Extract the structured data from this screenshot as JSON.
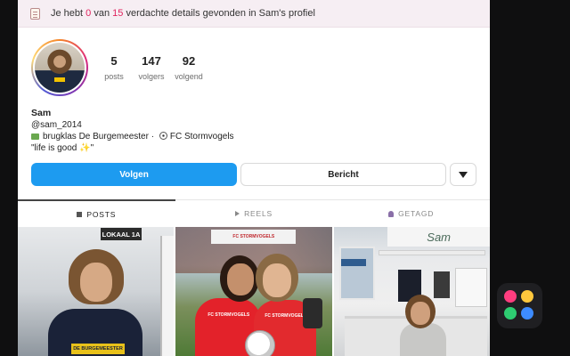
{
  "banner": {
    "prefix": "Je hebt",
    "found": "0",
    "middle": "van",
    "total": "15",
    "suffix": "verdachte details gevonden in Sam's profiel"
  },
  "profile": {
    "stats": [
      {
        "value": "5",
        "label": "posts"
      },
      {
        "value": "147",
        "label": "volgers"
      },
      {
        "value": "92",
        "label": "volgend"
      }
    ],
    "name": "Sam",
    "handle": "@sam_2014",
    "bio_school": "brugklas De Burgemeester",
    "bio_separator": "·",
    "bio_club": "FC Stormvogels",
    "bio_quote": "\"life is good ✨\""
  },
  "actions": {
    "follow_label": "Volgen",
    "message_label": "Bericht"
  },
  "tabs": [
    {
      "label": "POSTS",
      "icon": "grid-icon",
      "active": true
    },
    {
      "label": "REELS",
      "icon": "play-icon",
      "active": false
    },
    {
      "label": "GETAGD",
      "icon": "tagged-person-icon",
      "active": false
    }
  ],
  "posts": [
    {
      "sign": "LOKAAL 1A",
      "hoodie_text": "DE BURGEMEESTER"
    },
    {
      "banner_text": "FC STORMVOGELS",
      "shirt_text_1": "FC STORMVOGELS",
      "shirt_text_2": "FC STORMVOGELS"
    },
    {
      "board_text": "Sam"
    }
  ],
  "colors": {
    "accent": "#1d9bf0",
    "highlight_number": "#e0245e",
    "app_dots": [
      "#ff3d7f",
      "#ffc83d",
      "#2ecc71",
      "#3d8bff"
    ]
  }
}
